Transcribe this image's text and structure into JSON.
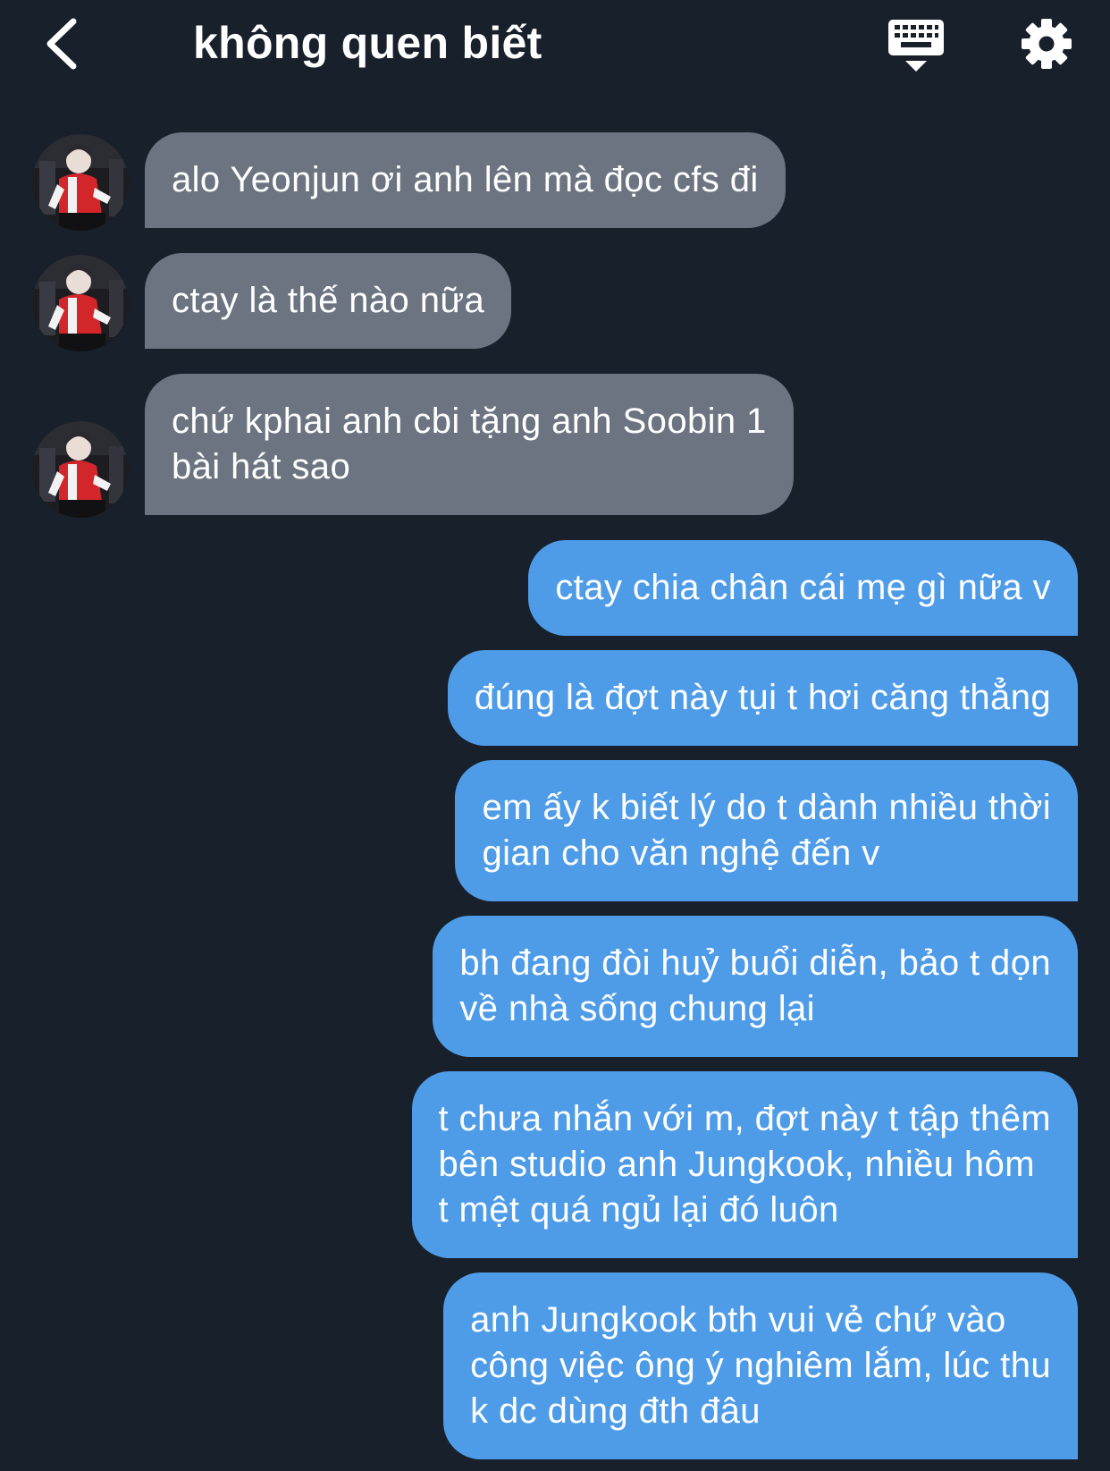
{
  "header": {
    "title": "không quen biết",
    "back_icon": "chevron-left-icon",
    "keyboard_icon": "keyboard-icon",
    "settings_icon": "gear-icon"
  },
  "colors": {
    "background": "#18202b",
    "incoming_bubble": "#6b7480",
    "outgoing_bubble": "#4e9ce8",
    "text": "#ffffff"
  },
  "messages": [
    {
      "from": "other",
      "lines": [
        "alo Yeonjun ơi anh lên mà đọc cfs đi"
      ]
    },
    {
      "from": "other",
      "lines": [
        "ctay là thế nào nữa"
      ]
    },
    {
      "from": "other",
      "lines": [
        "chứ kphai anh cbi tặng anh Soobin 1",
        "bài hát sao"
      ]
    },
    {
      "from": "me",
      "lines": [
        "ctay chia chân cái mẹ gì nữa v"
      ]
    },
    {
      "from": "me",
      "lines": [
        "đúng là đợt này tụi t hơi căng thẳng"
      ]
    },
    {
      "from": "me",
      "lines": [
        "em ấy k biết lý do t dành nhiều thời",
        "gian cho văn nghệ đến v"
      ]
    },
    {
      "from": "me",
      "lines": [
        "bh đang đòi huỷ buổi diễn, bảo t dọn",
        "về nhà sống chung lại"
      ]
    },
    {
      "from": "me",
      "lines": [
        "t chưa nhắn với m, đợt này t tập thêm",
        "bên studio anh Jungkook, nhiều hôm",
        "t mệt quá ngủ lại đó luôn"
      ]
    },
    {
      "from": "me",
      "lines": [
        "anh Jungkook bth vui vẻ chứ vào",
        "công việc ông ý nghiêm lắm, lúc thu",
        "k dc dùng đth đâu"
      ]
    }
  ]
}
